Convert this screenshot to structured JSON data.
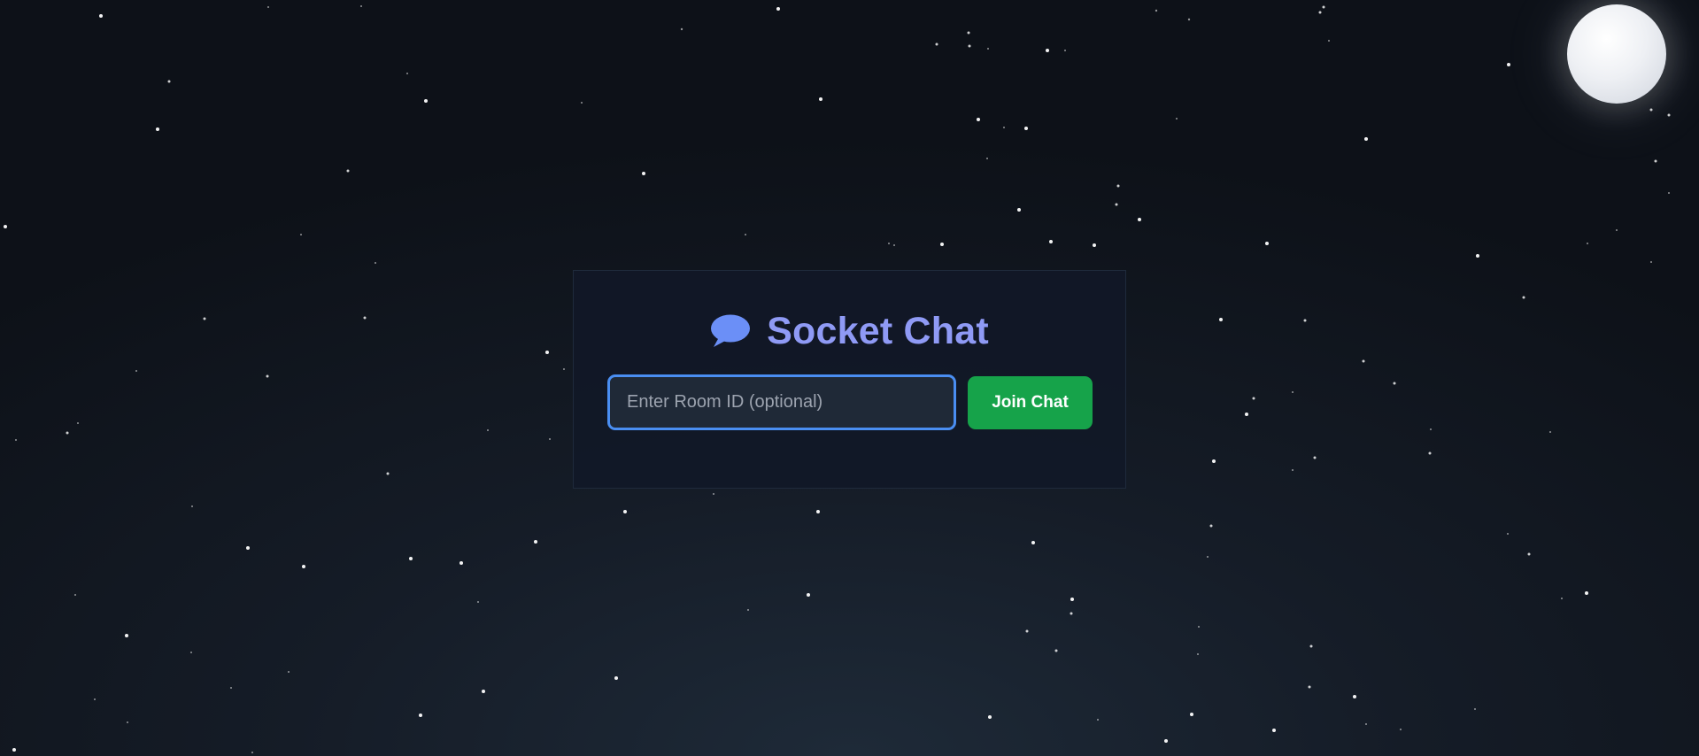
{
  "app": {
    "title": "Socket Chat",
    "title_icon": "speech-bubble-icon"
  },
  "join_form": {
    "room_input_value": "",
    "room_input_placeholder": "Enter Room ID (optional)",
    "join_button_label": "Join Chat"
  },
  "colors": {
    "title": "#8f9af5",
    "icon": "#6b8ff7",
    "input_border": "#4a8ef2",
    "join_button": "#16a34a",
    "background": "#0d1118"
  }
}
